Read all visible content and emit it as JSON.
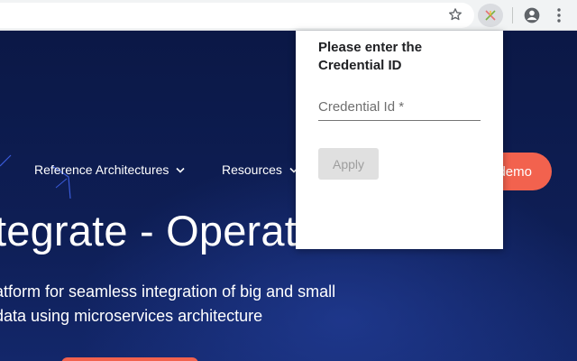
{
  "browser": {
    "icons": {
      "bookmark": "star-outline-icon",
      "extension": "extension-cross-icon",
      "profile": "account-circle-icon",
      "menu": "vertical-dots-icon"
    }
  },
  "page": {
    "nav": [
      {
        "label": "Reference Architectures"
      },
      {
        "label": "Resources"
      }
    ],
    "demo_button": "demo",
    "hero": {
      "title": "tegrate - Operat",
      "line1": "atform for seamless integration of big and small",
      "line2": "data using microservices architecture"
    },
    "colors": {
      "accent": "#f2624e",
      "background": "#0c1a4a"
    }
  },
  "popup": {
    "heading": "Please enter the Credential ID",
    "field": {
      "placeholder": "Credential Id *",
      "value": ""
    },
    "apply_label": "Apply"
  }
}
